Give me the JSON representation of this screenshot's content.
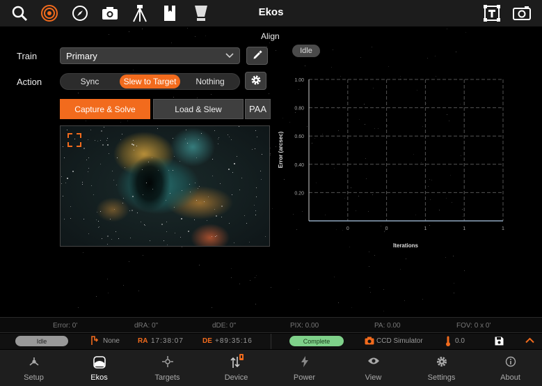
{
  "app": {
    "title": "Ekos",
    "module": "Align"
  },
  "colors": {
    "accent": "#f26b1d",
    "complete": "#7fd18a",
    "background": "#000000"
  },
  "toolbar": {
    "icons": [
      "search-icon",
      "target-icon",
      "compass-icon",
      "camera-icon",
      "tripod-icon",
      "bookmark-icon",
      "telescope-icon"
    ],
    "right_icons": [
      "text-tool-icon",
      "snapshot-icon"
    ]
  },
  "align": {
    "train_label": "Train",
    "train_value": "Primary",
    "action_label": "Action",
    "actions": [
      "Sync",
      "Slew to Target",
      "Nothing"
    ],
    "active_action": "Slew to Target",
    "capture_solve": "Capture & Solve",
    "load_slew": "Load & Slew",
    "paa": "PAA",
    "status": "Idle"
  },
  "chart_data": {
    "type": "line",
    "xlabel": "Iterations",
    "ylabel": "Error (arcsec)",
    "y_ticks": [
      "1.00",
      "0.80",
      "0.60",
      "0.40",
      "0.20"
    ],
    "x_ticks": [
      "0",
      "0",
      "1",
      "1",
      "1"
    ],
    "ylim": [
      0,
      1.0
    ],
    "grid": true,
    "series": []
  },
  "status_row": {
    "error": "Error: 0'",
    "dra": "dRA: 0\"",
    "dde": "dDE: 0\"",
    "pix": "PIX: 0.00",
    "pa": "PA: 0.00",
    "fov": "FOV: 0 x 0'"
  },
  "footer_status": {
    "mount_state": "Idle",
    "pier": "None",
    "ra_label": "RA",
    "ra_value": "17:38:07",
    "de_label": "DE",
    "de_value": "+89:35:16",
    "capture_state": "Complete",
    "camera": "CCD Simulator",
    "temperature": "0.0"
  },
  "nav": {
    "items": [
      {
        "label": "Setup",
        "icon": "setup-icon"
      },
      {
        "label": "Ekos",
        "icon": "ekos-icon"
      },
      {
        "label": "Targets",
        "icon": "targets-icon"
      },
      {
        "label": "Device",
        "icon": "device-icon"
      },
      {
        "label": "Power",
        "icon": "power-icon"
      },
      {
        "label": "View",
        "icon": "view-icon"
      },
      {
        "label": "Settings",
        "icon": "settings-icon"
      },
      {
        "label": "About",
        "icon": "about-icon"
      }
    ],
    "active": "Ekos"
  }
}
